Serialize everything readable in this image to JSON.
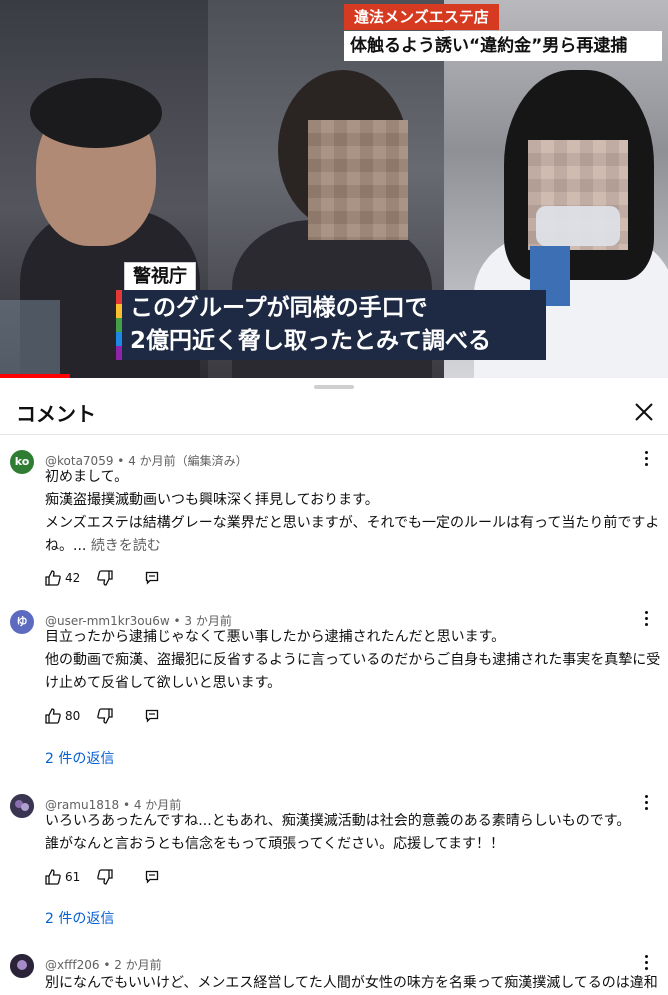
{
  "video": {
    "news_tag": "違法メンズエステ店",
    "headline": "体触るよう誘い“違約金”男ら再逮捕",
    "agency": "警視庁",
    "caption_line1": "このグループが同様の手口で",
    "caption_line2": "2億円近く脅し取ったとみて調べる",
    "progress": 0.105
  },
  "sheet": {
    "title": "コメント"
  },
  "comments": [
    {
      "avatar_text": "ko",
      "avatar_color": "#2e7d32",
      "author": "@kota7059",
      "time": "4 か月前（編集済み）",
      "lines": [
        "初めまして。",
        "痴漢盗撮撲滅動画いつも興味深く拝見しております。",
        "メンズエステは結構グレーな業界だと思いますが、それでも一定のルールは有って当たり前ですよ",
        "ね。..."
      ],
      "read_more": "続きを読む",
      "likes": "42"
    },
    {
      "avatar_text": "ゆ",
      "avatar_color": "#5c6bc0",
      "author": "@user-mm1kr3ou6w",
      "time": "3 か月前",
      "lines": [
        "目立ったから逮捕じゃなくて悪い事したから逮捕されたんだと思います。",
        "他の動画で痴漢、盗撮犯に反省するように言っているのだからご自身も逮捕された事実を真摯に受",
        "け止めて反省して欲しいと思います。"
      ],
      "likes": "80",
      "replies": "2 件の返信"
    },
    {
      "avatar_text": "",
      "avatar_color": "#3a3550",
      "author": "@ramu1818",
      "time": "4 か月前",
      "lines": [
        "いろいろあったんですね...ともあれ、痴漢撲滅活動は社会的意義のある素晴らしいものです。",
        "誰がなんと言おうとも信念をもって頑張ってください。応援してます！！"
      ],
      "likes": "61",
      "replies": "2 件の返信"
    },
    {
      "avatar_text": "",
      "avatar_color": "#2b2438",
      "author": "@xfff206",
      "time": "2 か月前",
      "lines": [
        "別になんでもいいけど、メンエス経営してた人間が女性の味方を名乗って痴漢撲滅してるのは違和"
      ]
    }
  ],
  "colors": {
    "link": "#065fd4",
    "news_red": "#d63a20",
    "caption_bg": "#1e2a44",
    "progress_red": "#ff0000"
  },
  "icons": [
    "like-icon",
    "dislike-icon",
    "reply-icon",
    "close-icon",
    "more-vert-icon"
  ]
}
